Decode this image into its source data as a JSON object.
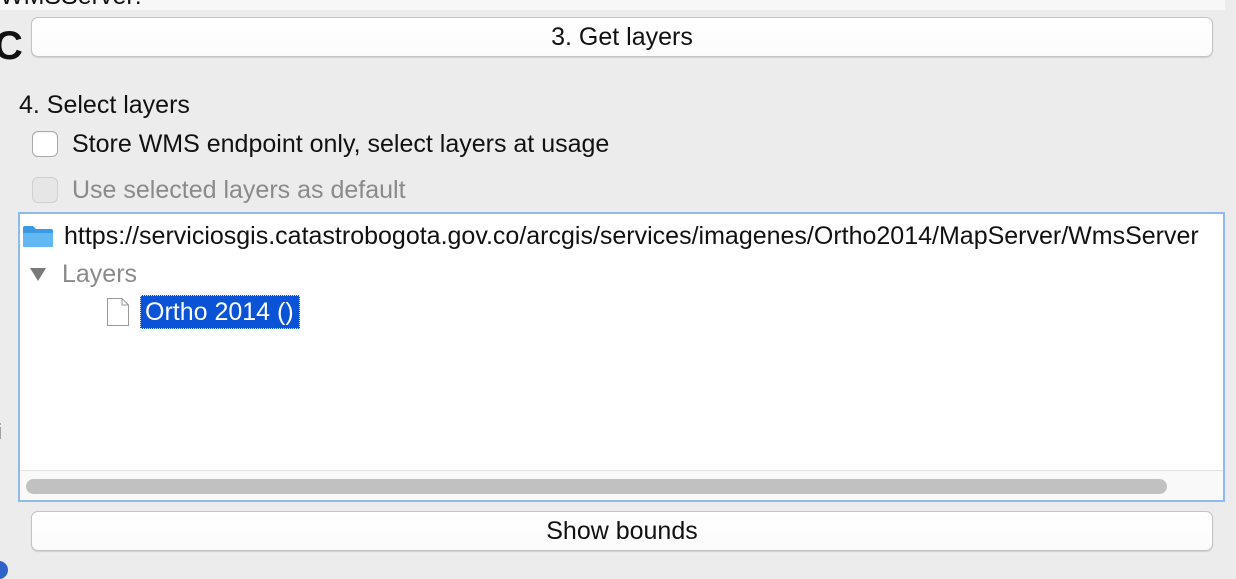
{
  "top_strip": {
    "cut_text": "WMSServer:"
  },
  "buttons": {
    "get_layers": "3. Get layers",
    "show_bounds": "Show bounds"
  },
  "select_layers": {
    "heading": "4. Select layers",
    "store_endpoint_only": {
      "label": "Store WMS endpoint only, select layers at usage",
      "checked": false,
      "enabled": true
    },
    "use_selected_default": {
      "label": "Use selected layers as default",
      "checked": false,
      "enabled": false
    }
  },
  "tree": {
    "root_label": "https://serviciosgis.catastrobogota.gov.co/arcgis/services/imagenes/Ortho2014/MapServer/WmsServer",
    "group_label": "Layers",
    "group_expanded": true,
    "leaf_label": "Ortho 2014 ()",
    "leaf_selected": true
  },
  "icons": {
    "folder": "folder-icon",
    "disclosure": "disclosure-triangle-icon",
    "file": "file-icon"
  },
  "colors": {
    "selection": "#0a52d6",
    "focus_border": "#8fbaf0",
    "folder_blue": "#4aa8ec"
  }
}
